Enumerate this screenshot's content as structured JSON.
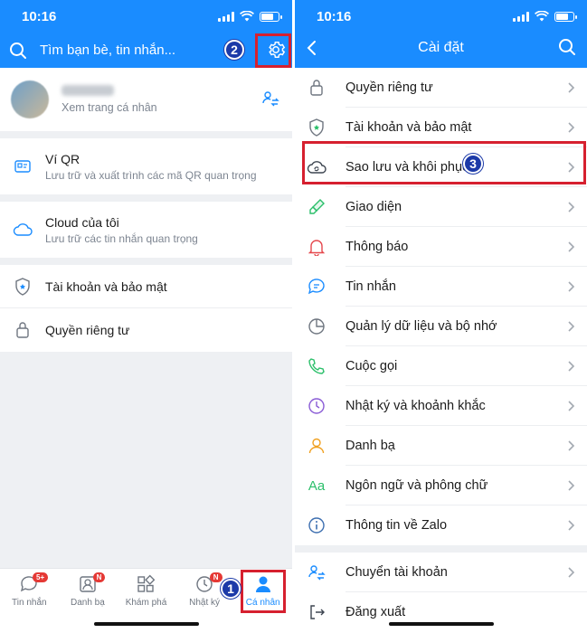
{
  "status": {
    "time": "10:16"
  },
  "left": {
    "search_placeholder": "Tìm bạn bè, tin nhắn...",
    "profile": {
      "subtitle": "Xem trang cá nhân"
    },
    "items": [
      {
        "title": "Ví QR",
        "sub": "Lưu trữ và xuất trình các mã QR quan trọng"
      },
      {
        "title": "Cloud của tôi",
        "sub": "Lưu trữ các tin nhắn quan trọng"
      },
      {
        "title": "Tài khoản và bảo mật"
      },
      {
        "title": "Quyền riêng tư"
      }
    ],
    "nav": [
      {
        "label": "Tin nhắn",
        "badge": "5+"
      },
      {
        "label": "Danh bạ",
        "badge": "N"
      },
      {
        "label": "Khám phá"
      },
      {
        "label": "Nhật ký",
        "badge": "N"
      },
      {
        "label": "Cá nhân"
      }
    ]
  },
  "right": {
    "title": "Cài đặt",
    "items": [
      {
        "label": "Quyền riêng tư",
        "icon": "lock-icon"
      },
      {
        "label": "Tài khoản và bảo mật",
        "icon": "shield-icon"
      },
      {
        "label": "Sao lưu và khôi phục",
        "icon": "cloud-sync-icon"
      },
      {
        "label": "Giao diện",
        "icon": "brush-icon"
      },
      {
        "label": "Thông báo",
        "icon": "bell-icon"
      },
      {
        "label": "Tin nhắn",
        "icon": "chat-icon"
      },
      {
        "label": "Quản lý dữ liệu và bộ nhớ",
        "icon": "pie-icon"
      },
      {
        "label": "Cuộc gọi",
        "icon": "phone-icon"
      },
      {
        "label": "Nhật ký và khoảnh khắc",
        "icon": "clock-icon"
      },
      {
        "label": "Danh bạ",
        "icon": "person-icon"
      },
      {
        "label": "Ngôn ngữ và phông chữ",
        "icon": "font-icon"
      },
      {
        "label": "Thông tin về Zalo",
        "icon": "info-icon"
      },
      {
        "label": "Chuyển tài khoản",
        "icon": "switch-account-icon"
      },
      {
        "label": "Đăng xuất",
        "icon": "logout-icon"
      }
    ],
    "font_glyph": "Aa"
  },
  "steps": {
    "one": "1",
    "two": "2",
    "three": "3"
  },
  "colors": {
    "brand": "#1a8cff",
    "highlight": "#d6202f",
    "step": "#1c3aa8",
    "badge": "#e53935"
  }
}
